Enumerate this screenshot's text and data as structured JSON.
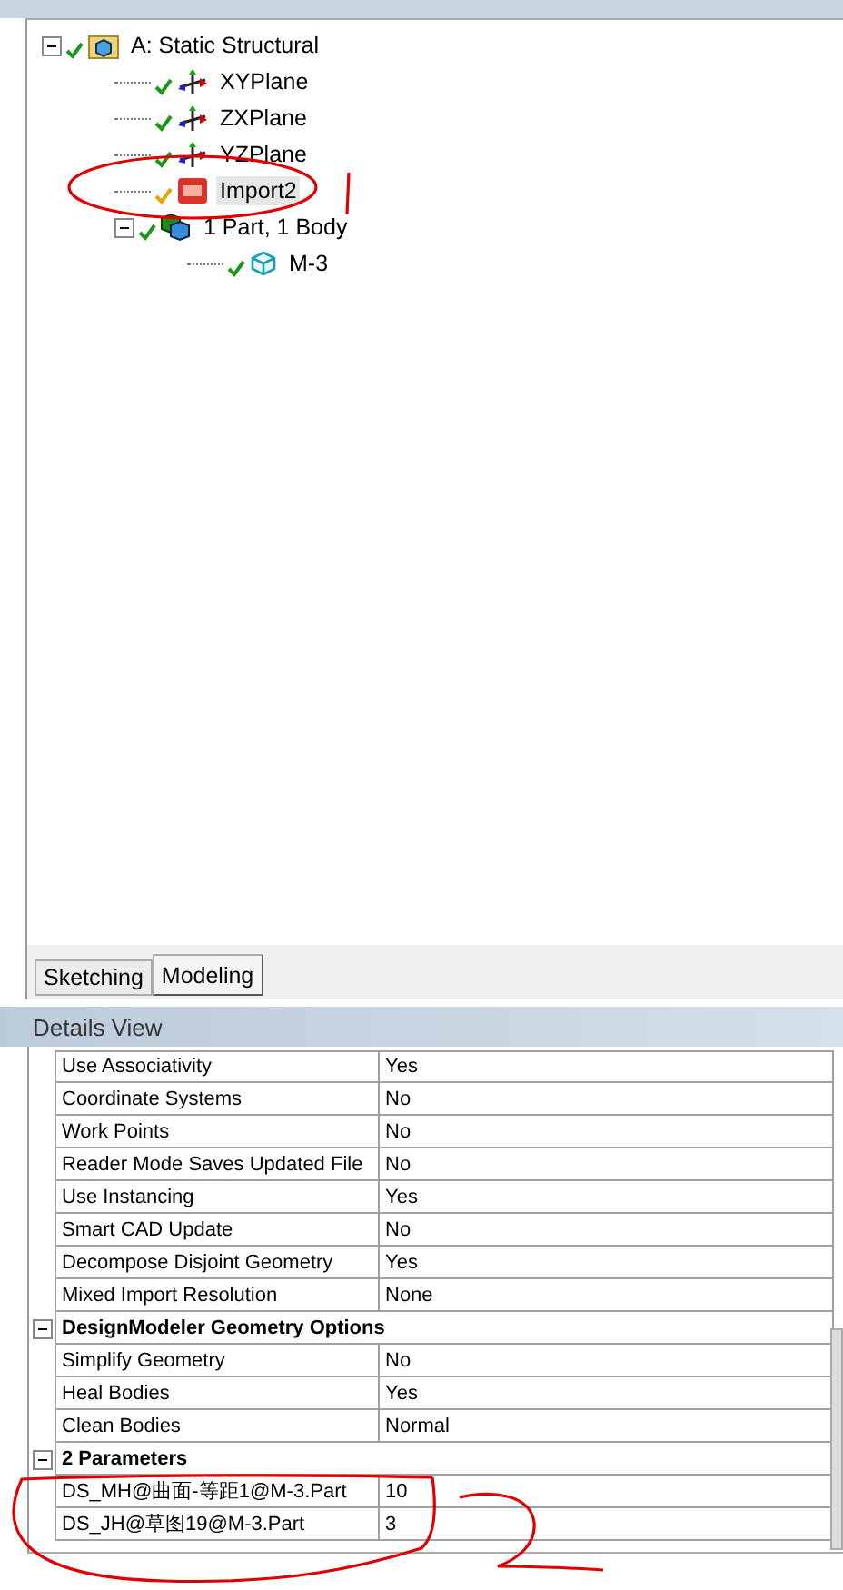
{
  "tree": [
    {
      "label": "A: Static Structural",
      "kind": "root",
      "color": "#1a9a1a",
      "expanded": true,
      "children": [
        {
          "label": "XYPlane",
          "kind": "plane",
          "color": "#1a9a1a"
        },
        {
          "label": "ZXPlane",
          "kind": "plane",
          "color": "#1a9a1a"
        },
        {
          "label": "YZPlane",
          "kind": "plane",
          "color": "#1a9a1a"
        },
        {
          "label": "Import2",
          "kind": "import",
          "color": "#e0a800",
          "selected": true
        },
        {
          "label": "1 Part, 1 Body",
          "kind": "parts",
          "color": "#1a9a1a",
          "expanded": true,
          "children": [
            {
              "label": "M-3",
              "kind": "body",
              "color": "#1a9a1a"
            }
          ]
        }
      ]
    }
  ],
  "tabs": [
    {
      "label": "Sketching",
      "selected": false
    },
    {
      "label": "Modeling",
      "selected": true
    }
  ],
  "details": {
    "title": "Details View",
    "rows": [
      {
        "kind": "prop",
        "label": "Use Associativity",
        "value": "Yes"
      },
      {
        "kind": "prop",
        "label": "Coordinate Systems",
        "value": "No"
      },
      {
        "kind": "prop",
        "label": "Work Points",
        "value": "No"
      },
      {
        "kind": "prop",
        "label": "Reader Mode Saves Updated File",
        "value": "No"
      },
      {
        "kind": "prop",
        "label": "Use Instancing",
        "value": "Yes"
      },
      {
        "kind": "prop",
        "label": "Smart CAD Update",
        "value": "No"
      },
      {
        "kind": "prop",
        "label": "Decompose Disjoint Geometry",
        "value": "Yes"
      },
      {
        "kind": "prop",
        "label": "Mixed Import Resolution",
        "value": "None"
      },
      {
        "kind": "group",
        "label": "DesignModeler Geometry Options",
        "expanded": true
      },
      {
        "kind": "prop",
        "label": "Simplify Geometry",
        "value": "No"
      },
      {
        "kind": "prop",
        "label": "Heal Bodies",
        "value": "Yes"
      },
      {
        "kind": "prop",
        "label": "Clean Bodies",
        "value": "Normal"
      },
      {
        "kind": "group",
        "label": "2 Parameters",
        "expanded": true
      },
      {
        "kind": "prop",
        "label": "DS_MH@曲面-等距1@M-3.Part",
        "value": "10"
      },
      {
        "kind": "prop",
        "label": "DS_JH@草图19@M-3.Part",
        "value": "3"
      }
    ]
  }
}
